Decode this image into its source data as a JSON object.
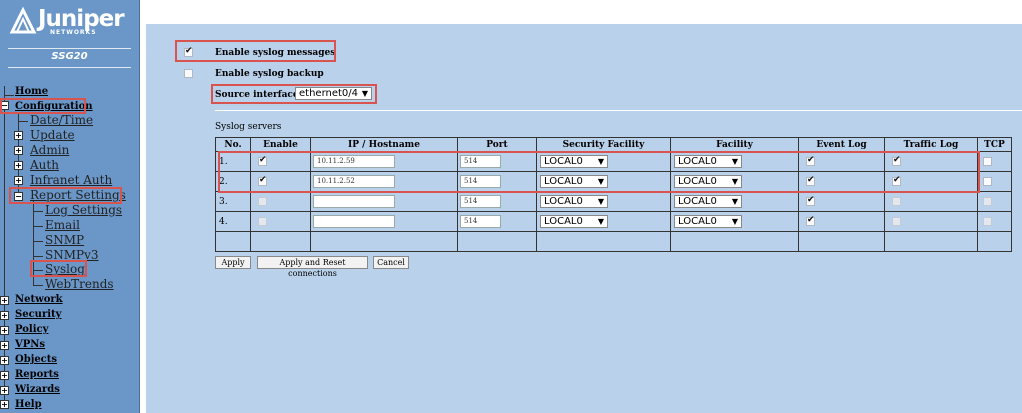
{
  "brand": {
    "name": "Juniper",
    "sub": "NETWORKS",
    "device": "SSG20"
  },
  "nav": {
    "home": "Home",
    "configuration": "Configuration",
    "date_time": "Date/Time",
    "update": "Update",
    "admin": "Admin",
    "auth": "Auth",
    "infranet_auth": "Infranet Auth",
    "report_settings": "Report Settings",
    "log_settings": "Log Settings",
    "email": "Email",
    "snmp": "SNMP",
    "snmpv3": "SNMPv3",
    "syslog": "Syslog",
    "webtrends": "WebTrends",
    "network": "Network",
    "security": "Security",
    "policy": "Policy",
    "vpns": "VPNs",
    "objects": "Objects",
    "reports": "Reports",
    "wizards": "Wizards",
    "help": "Help"
  },
  "form": {
    "enable_syslog_label": "Enable syslog messages",
    "enable_syslog_checked": true,
    "enable_backup_label": "Enable syslog backup",
    "enable_backup_checked": false,
    "source_interface_label": "Source interface",
    "source_interface_value": "ethernet0/4",
    "servers_caption": "Syslog servers"
  },
  "table": {
    "headers": [
      "No.",
      "Enable",
      "IP / Hostname",
      "Port",
      "Security Facility",
      "Facility",
      "Event Log",
      "Traffic Log",
      "TCP"
    ],
    "rows": [
      {
        "no": "1.",
        "enable": true,
        "ip": "10.11.2.59",
        "port": "514",
        "sec_facility": "LOCAL0",
        "facility": "LOCAL0",
        "event_log": true,
        "traffic_log": true,
        "tcp": false
      },
      {
        "no": "2.",
        "enable": true,
        "ip": "10.11.2.52",
        "port": "514",
        "sec_facility": "LOCAL0",
        "facility": "LOCAL0",
        "event_log": true,
        "traffic_log": true,
        "tcp": false
      },
      {
        "no": "3.",
        "enable": false,
        "ip": "",
        "port": "514",
        "sec_facility": "LOCAL0",
        "facility": "LOCAL0",
        "event_log": true,
        "traffic_log": false,
        "tcp": false
      },
      {
        "no": "4.",
        "enable": false,
        "ip": "",
        "port": "514",
        "sec_facility": "LOCAL0",
        "facility": "LOCAL0",
        "event_log": true,
        "traffic_log": false,
        "tcp": false
      }
    ]
  },
  "buttons": {
    "apply": "Apply",
    "apply_reset": "Apply and Reset connections",
    "cancel": "Cancel"
  },
  "colors": {
    "highlight": "#d9534f",
    "sidebar": "#6a96c8",
    "content": "#b9d1ea"
  }
}
